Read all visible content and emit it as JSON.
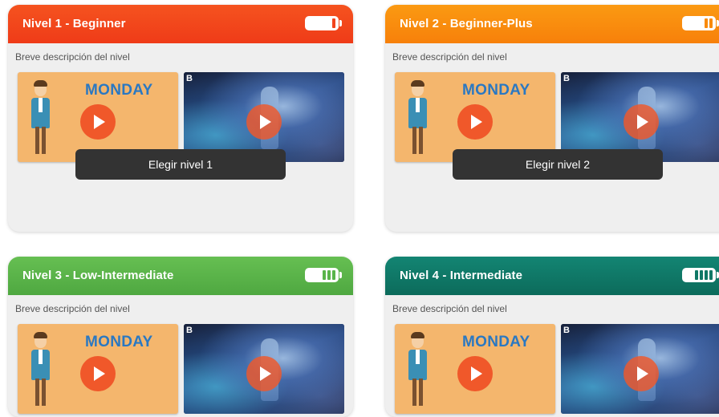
{
  "description_text": "Breve descripción del nivel",
  "thumbnail_left": {
    "title": "MONDAY",
    "logo": "B"
  },
  "thumbnail_right": {
    "logo": "B"
  },
  "cards": [
    {
      "title": "Nivel 1 - Beginner",
      "button_label": "Elegir nivel 1",
      "battery_level": 1,
      "header_color": "#f2431c"
    },
    {
      "title": "Nivel 2 - Beginner-Plus",
      "button_label": "Elegir nivel 2",
      "battery_level": 2,
      "header_color": "#f98a0b"
    },
    {
      "title": "Nivel 3 - Low-Intermediate",
      "button_label": "",
      "battery_level": 3,
      "header_color": "#59b44a"
    },
    {
      "title": "Nivel 4 - Intermediate",
      "button_label": "",
      "battery_level": 4,
      "header_color": "#0f7866"
    }
  ],
  "icons": {
    "battery": "battery-level-icon",
    "play": "play-icon"
  }
}
